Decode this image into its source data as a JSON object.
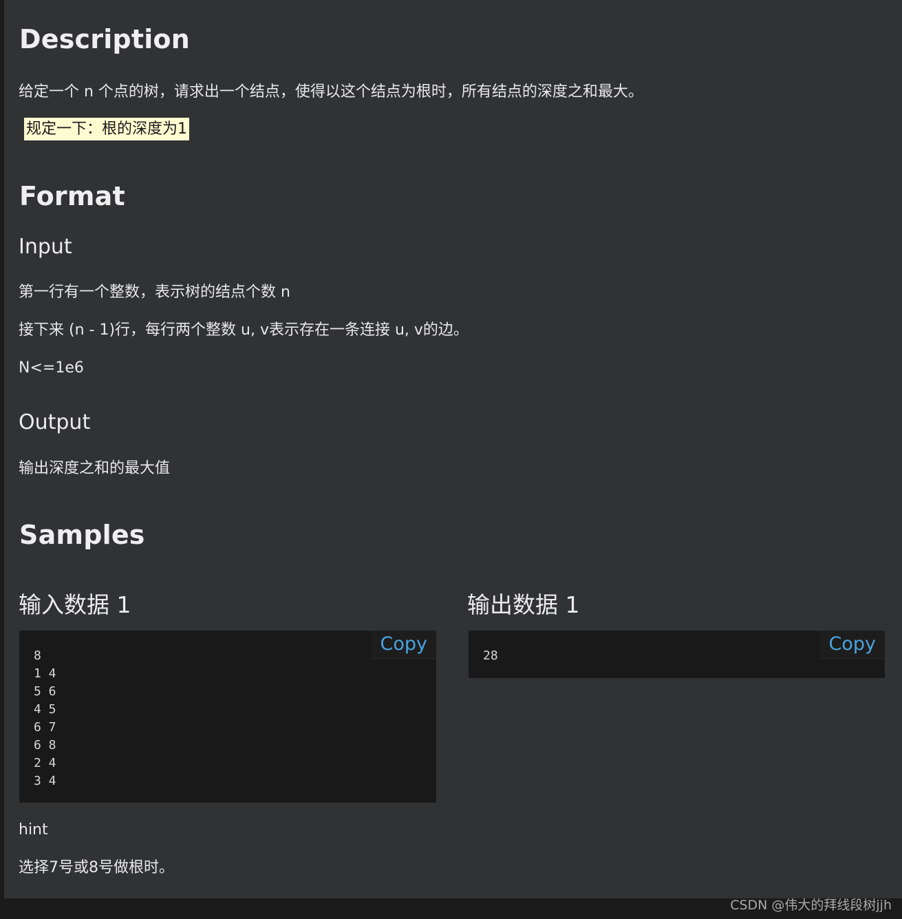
{
  "description": {
    "heading": "Description",
    "text": "给定一个 n 个点的树，请求出一个结点，使得以这个结点为根时，所有结点的深度之和最大。",
    "highlight": "规定一下：根的深度为1"
  },
  "format": {
    "heading": "Format",
    "input": {
      "heading": "Input",
      "line1": "第一行有一个整数，表示树的结点个数 n",
      "line2": "接下来 (n - 1)行，每行两个整数 u, v表示存在一条连接 u, v的边。",
      "line3": "N<=1e6"
    },
    "output": {
      "heading": "Output",
      "line1": "输出深度之和的最大值"
    }
  },
  "samples": {
    "heading": "Samples",
    "input": {
      "title": "输入数据 1",
      "copy_label": "Copy",
      "lines": [
        "8",
        "1 4",
        "5 6",
        "4 5",
        "6 7",
        "6 8",
        "2 4",
        "3 4"
      ]
    },
    "output": {
      "title": "输出数据 1",
      "copy_label": "Copy",
      "lines": [
        "28"
      ]
    }
  },
  "hint": {
    "label": "hint",
    "text": "选择7号或8号做根时。"
  },
  "watermark": "CSDN @伟大的拜线段树jjh"
}
